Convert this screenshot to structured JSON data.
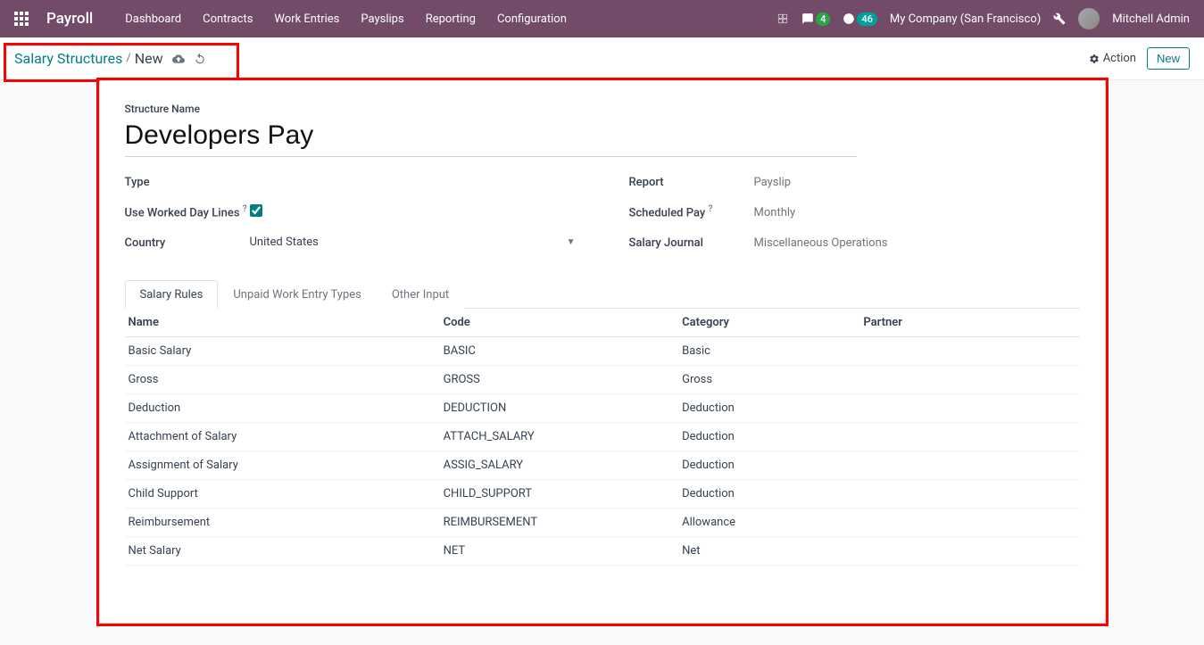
{
  "navbar": {
    "brand": "Payroll",
    "menu": [
      "Dashboard",
      "Contracts",
      "Work Entries",
      "Payslips",
      "Reporting",
      "Configuration"
    ],
    "messages_badge": "4",
    "activities_badge": "46",
    "company": "My Company (San Francisco)",
    "user": "Mitchell Admin"
  },
  "control": {
    "breadcrumb_root": "Salary Structures",
    "breadcrumb_current": "New",
    "action_label": "Action",
    "new_label": "New"
  },
  "form": {
    "structure_name_label": "Structure Name",
    "structure_name_value": "Developers Pay",
    "left": {
      "type_label": "Type",
      "type_value": "",
      "worked_day_label": "Use Worked Day Lines",
      "worked_day_checked": true,
      "country_label": "Country",
      "country_value": "United States"
    },
    "right": {
      "report_label": "Report",
      "report_value": "Payslip",
      "scheduled_label": "Scheduled Pay",
      "scheduled_value": "Monthly",
      "journal_label": "Salary Journal",
      "journal_value": "Miscellaneous Operations"
    }
  },
  "tabs": [
    "Salary Rules",
    "Unpaid Work Entry Types",
    "Other Input"
  ],
  "table": {
    "headers": [
      "Name",
      "Code",
      "Category",
      "Partner"
    ],
    "rows": [
      {
        "name": "Basic Salary",
        "code": "BASIC",
        "category": "Basic",
        "partner": ""
      },
      {
        "name": "Gross",
        "code": "GROSS",
        "category": "Gross",
        "partner": ""
      },
      {
        "name": "Deduction",
        "code": "DEDUCTION",
        "category": "Deduction",
        "partner": ""
      },
      {
        "name": "Attachment of Salary",
        "code": "ATTACH_SALARY",
        "category": "Deduction",
        "partner": ""
      },
      {
        "name": "Assignment of Salary",
        "code": "ASSIG_SALARY",
        "category": "Deduction",
        "partner": ""
      },
      {
        "name": "Child Support",
        "code": "CHILD_SUPPORT",
        "category": "Deduction",
        "partner": ""
      },
      {
        "name": "Reimbursement",
        "code": "REIMBURSEMENT",
        "category": "Allowance",
        "partner": ""
      },
      {
        "name": "Net Salary",
        "code": "NET",
        "category": "Net",
        "partner": ""
      }
    ]
  }
}
